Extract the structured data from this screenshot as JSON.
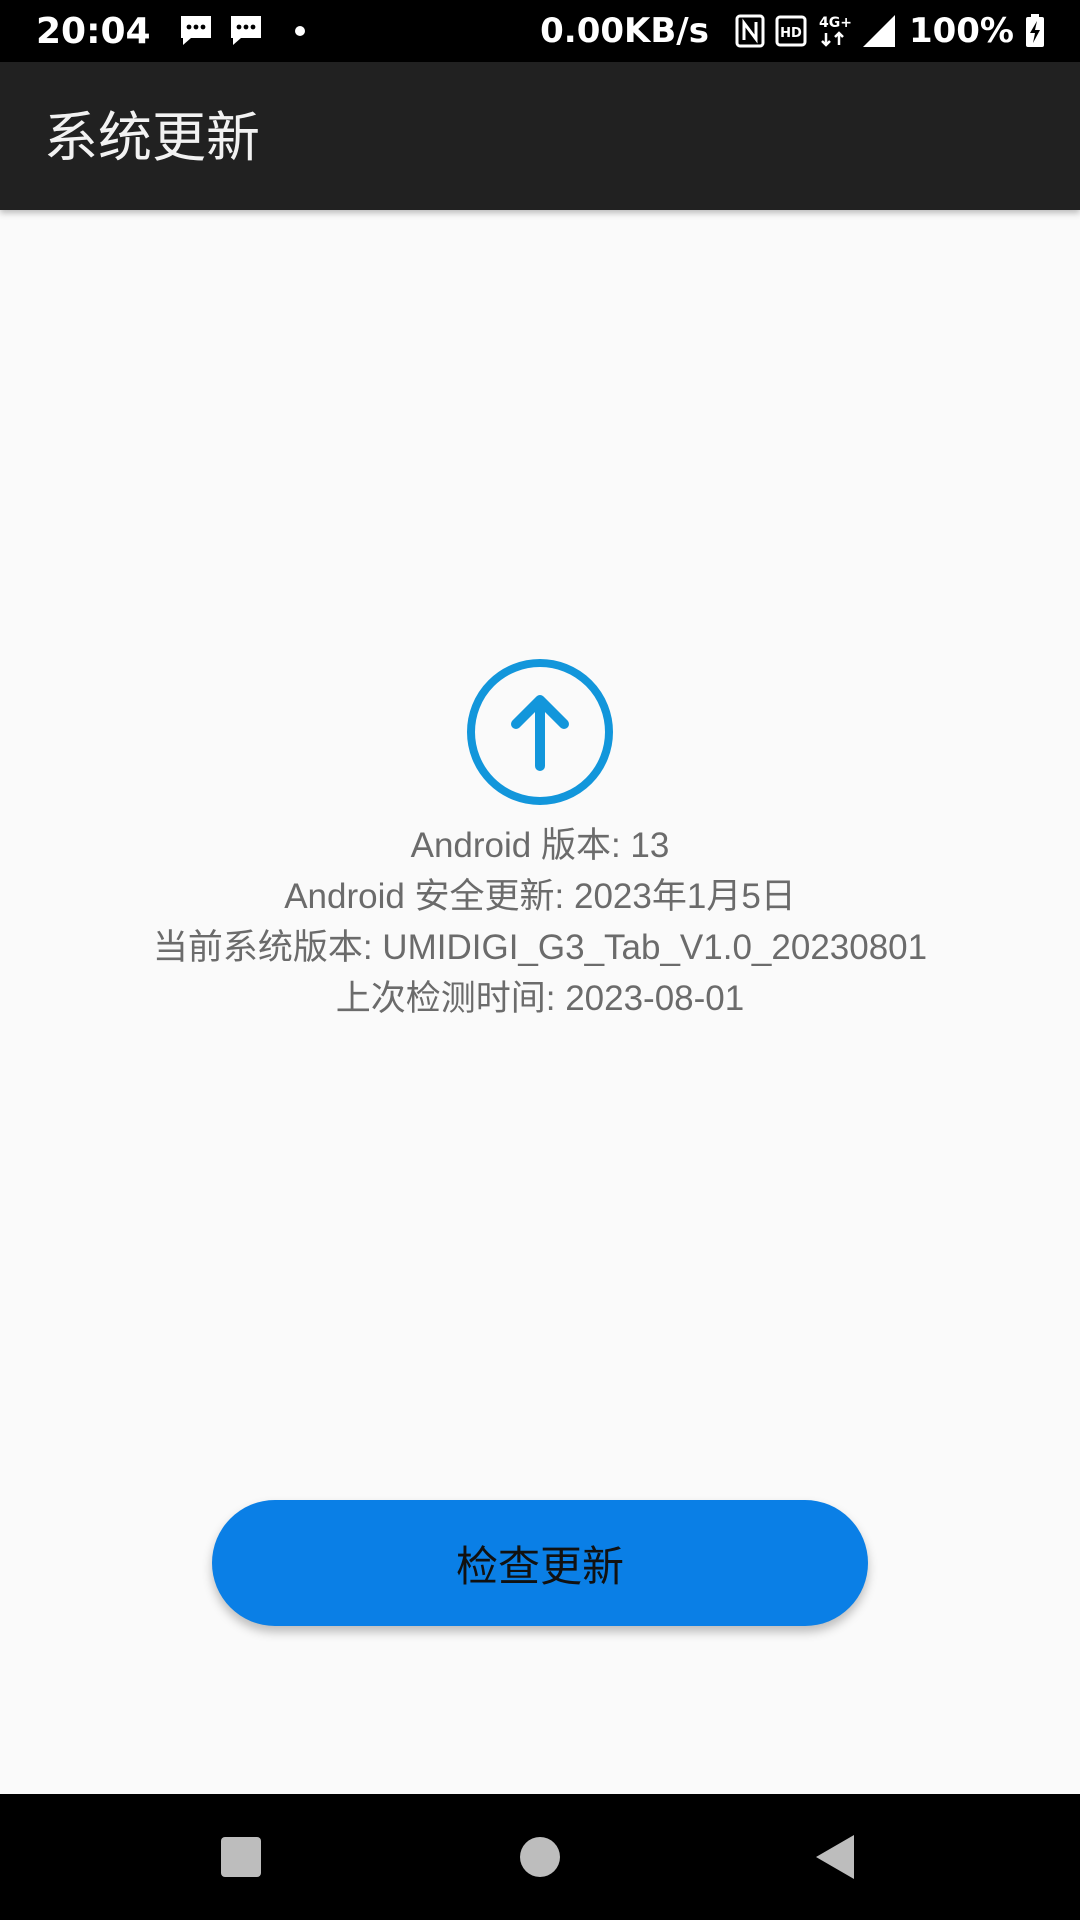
{
  "status_bar": {
    "time": "20:04",
    "network_speed": "0.00KB/s",
    "network_type": "4G+",
    "battery": "100%",
    "icons": [
      "message-icon",
      "message-icon",
      "dot",
      "nfc-icon",
      "hd-icon",
      "4g-icon",
      "signal-icon",
      "battery-charging-icon"
    ]
  },
  "app_bar": {
    "title": "系统更新"
  },
  "main": {
    "icon": "arrow-up-circle-icon",
    "accent_color": "#1296db",
    "info": [
      "Android 版本: 13",
      "Android 安全更新: 2023年1月5日",
      "当前系统版本: UMIDIGI_G3_Tab_V1.0_20230801",
      "上次检测时间: 2023-08-01"
    ],
    "check_button_label": "检查更新",
    "button_color": "#0a7fe6"
  },
  "nav_bar": {
    "buttons": [
      "recent-apps-button",
      "home-button",
      "back-button"
    ]
  }
}
